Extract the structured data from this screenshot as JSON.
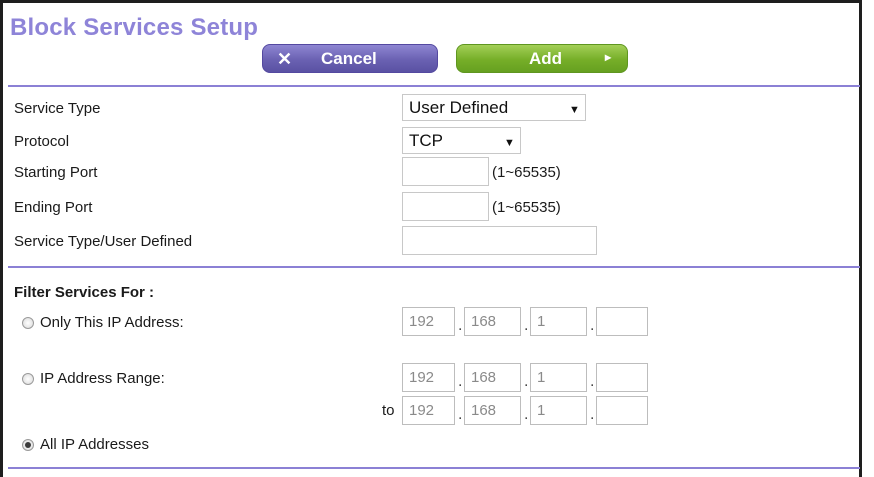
{
  "page_title": "Block Services Setup",
  "buttons": {
    "cancel_icon": "✕",
    "cancel": "Cancel",
    "add": "Add",
    "add_icon": "▸"
  },
  "fields": {
    "service_type": {
      "label": "Service Type",
      "value": "User Defined"
    },
    "protocol": {
      "label": "Protocol",
      "value": "TCP"
    },
    "starting_port": {
      "label": "Starting Port",
      "value": "",
      "hint": "(1~65535)"
    },
    "ending_port": {
      "label": "Ending Port",
      "value": "",
      "hint": "(1~65535)"
    },
    "service_name": {
      "label": "Service Type/User Defined",
      "value": ""
    }
  },
  "filter": {
    "heading": "Filter Services For :",
    "only_ip": {
      "label": "Only This IP Address:",
      "selected": false,
      "octets": [
        "192",
        "168",
        "1",
        ""
      ]
    },
    "range": {
      "label": "IP Address Range:",
      "selected": false,
      "start": [
        "192",
        "168",
        "1",
        ""
      ],
      "to_label": "to",
      "end": [
        "192",
        "168",
        "1",
        ""
      ]
    },
    "all": {
      "label": "All IP Addresses",
      "selected": true
    }
  },
  "colors": {
    "accent": "#8b80d5",
    "cancel": "#6a61b2",
    "add": "#76ae28"
  }
}
